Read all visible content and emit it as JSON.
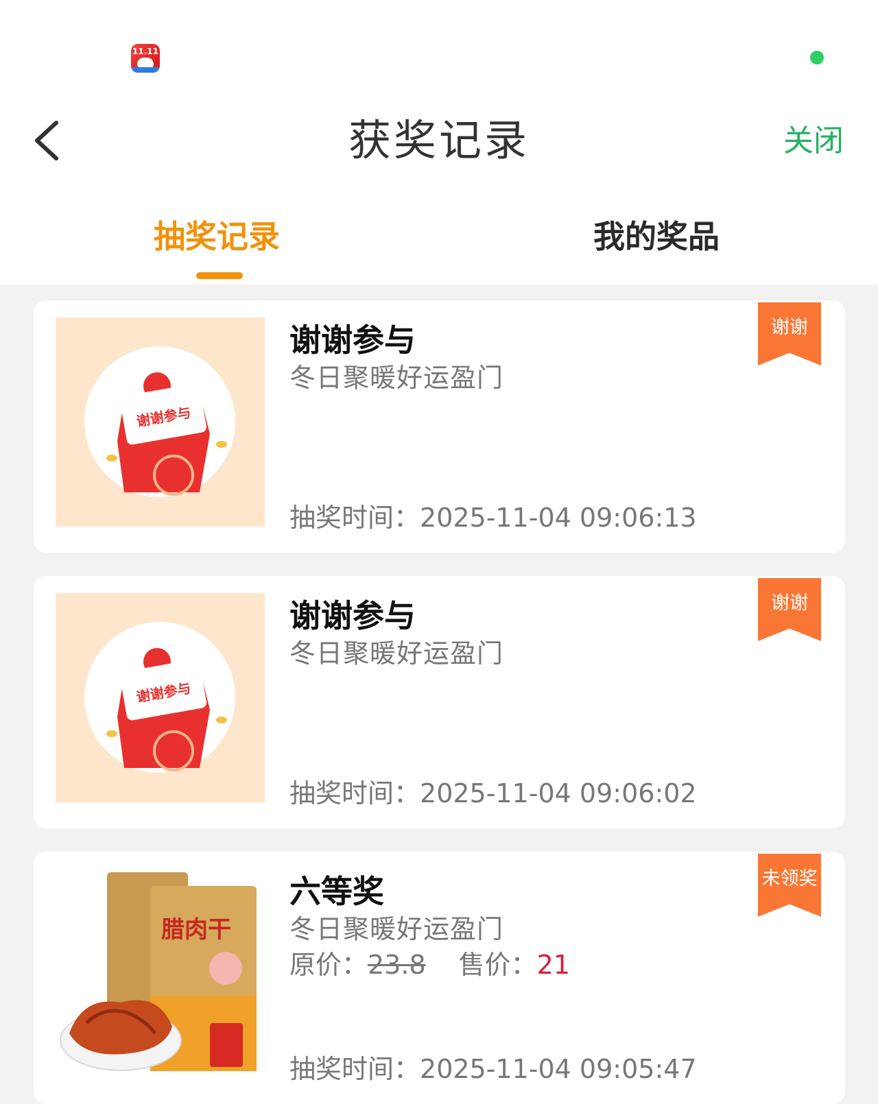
{
  "status_bar": {
    "app_icon": "shopping-festival-app-icon",
    "app_icon_text": "11.11",
    "indicator_color": "#2fcf63"
  },
  "header": {
    "back_icon": "chevron-left-icon",
    "title": "获奖记录",
    "close_label": "关闭",
    "close_color": "#24b15e"
  },
  "tabs": {
    "items": [
      {
        "label": "抽奖记录",
        "active": true
      },
      {
        "label": "我的奖品",
        "active": false
      }
    ],
    "active_color": "#f0920c"
  },
  "records": [
    {
      "title": "谢谢参与",
      "subtitle": "冬日聚暖好运盈门",
      "time_label": "抽奖时间：",
      "time_value": "2025-11-04 09:06:13",
      "badge": "谢谢",
      "image": "thank-you-red-envelope",
      "image_text": "谢谢参与"
    },
    {
      "title": "谢谢参与",
      "subtitle": "冬日聚暖好运盈门",
      "time_label": "抽奖时间：",
      "time_value": "2025-11-04 09:06:02",
      "badge": "谢谢",
      "image": "thank-you-red-envelope",
      "image_text": "谢谢参与"
    },
    {
      "title": "六等奖",
      "subtitle": "冬日聚暖好运盈门",
      "original_price_label": "原价：",
      "original_price": "23.8",
      "sale_price_label": "售价：",
      "sale_price": "21",
      "time_label": "抽奖时间：",
      "time_value": "2025-11-04 09:05:47",
      "badge": "未领奖",
      "image": "cured-beef-jerky-package",
      "image_text": "腊肉干"
    }
  ],
  "colors": {
    "badge": "#fa7634",
    "sale_price": "#d81e35",
    "page_background": "#f2f2f2"
  }
}
